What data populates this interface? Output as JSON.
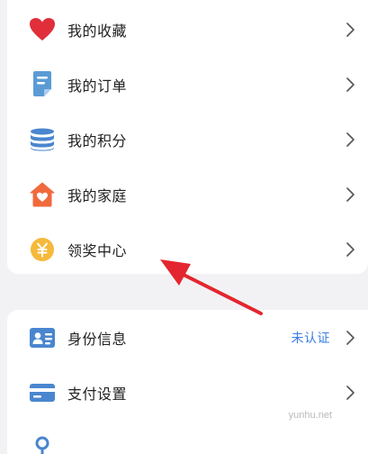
{
  "menu_group_1": {
    "items": [
      {
        "label": "我的收藏",
        "icon": "heart-icon",
        "icon_color": "#e02e3b"
      },
      {
        "label": "我的订单",
        "icon": "order-document-icon",
        "icon_color": "#5b9bd5"
      },
      {
        "label": "我的积分",
        "icon": "points-stack-icon",
        "icon_color": "#4a86cf"
      },
      {
        "label": "我的家庭",
        "icon": "family-house-icon",
        "icon_color": "#f06a3c"
      },
      {
        "label": "领奖中心",
        "icon": "yuan-coin-icon",
        "icon_color": "#f5b93b"
      }
    ]
  },
  "menu_group_2": {
    "items": [
      {
        "label": "身份信息",
        "icon": "id-card-icon",
        "icon_color": "#4a86cf",
        "status": "未认证"
      },
      {
        "label": "支付设置",
        "icon": "payment-card-icon",
        "icon_color": "#4a86cf"
      }
    ]
  },
  "annotation": {
    "type": "red-arrow",
    "color": "#e3262f"
  },
  "watermark": "yunhu.net"
}
